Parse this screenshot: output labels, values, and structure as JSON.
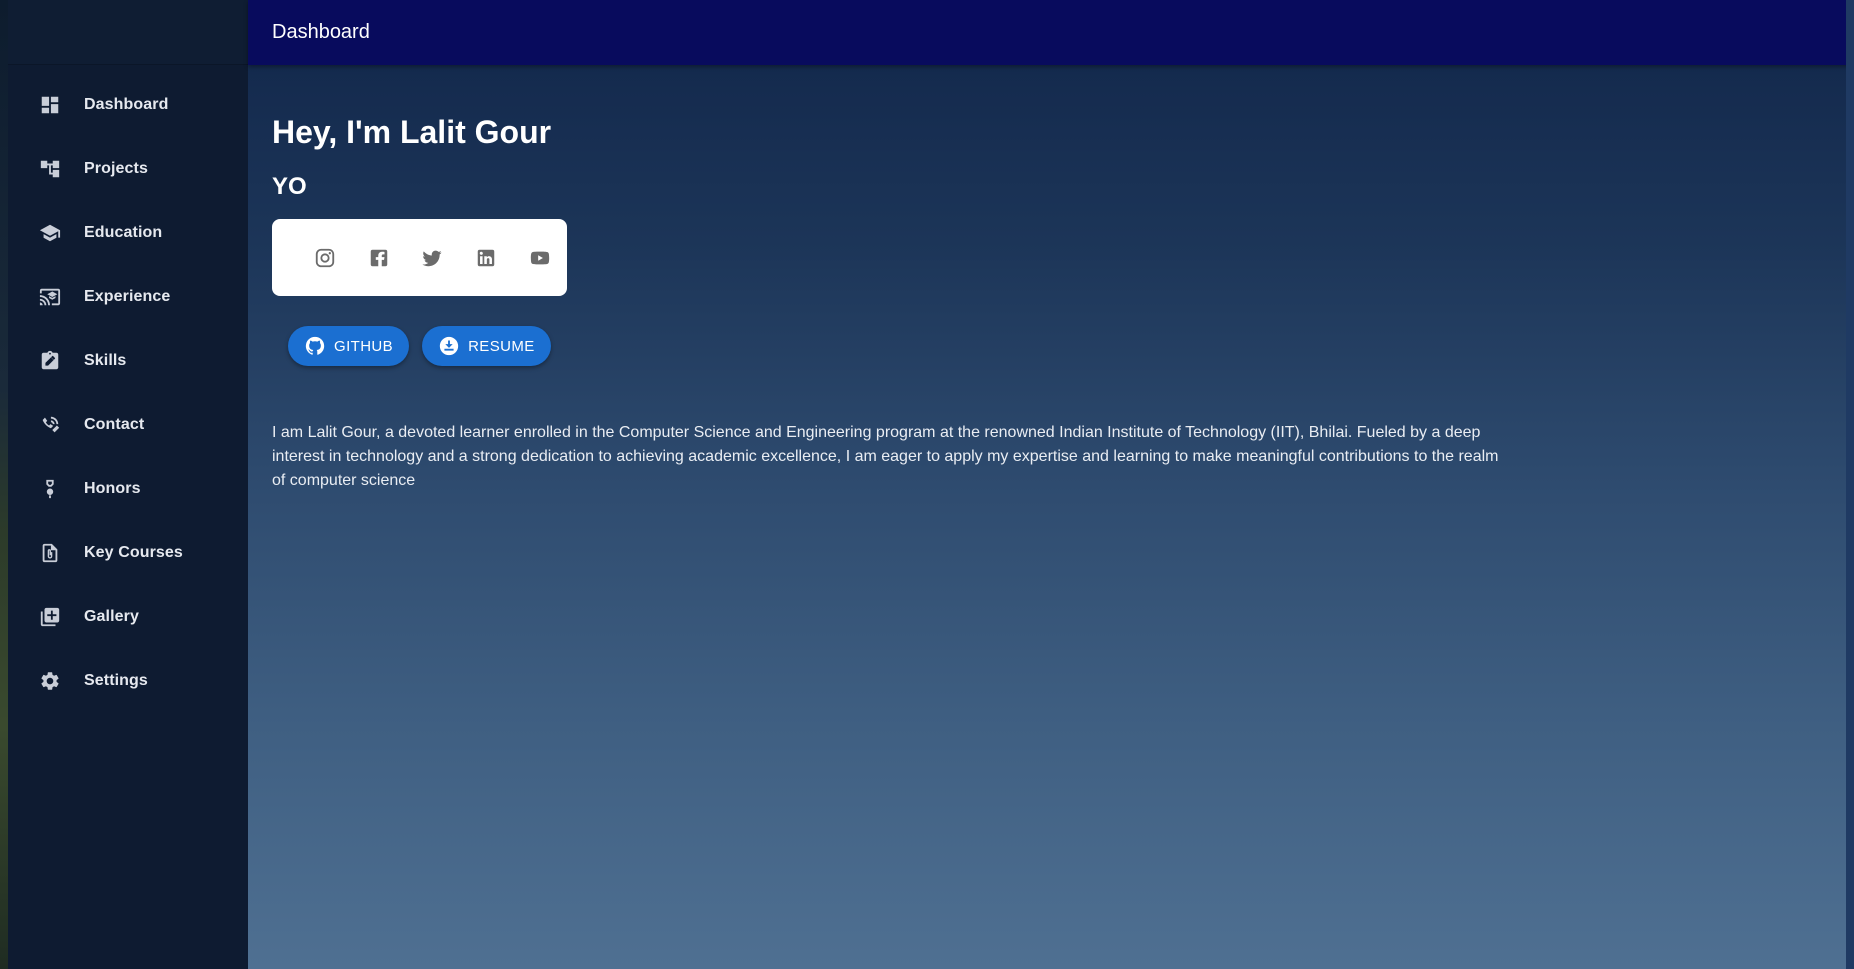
{
  "appbar": {
    "title": "Dashboard"
  },
  "sidebar": {
    "items": [
      {
        "label": "Dashboard",
        "icon": "dashboard-icon"
      },
      {
        "label": "Projects",
        "icon": "projects-icon"
      },
      {
        "label": "Education",
        "icon": "school-icon"
      },
      {
        "label": "Experience",
        "icon": "cast-for-education-icon"
      },
      {
        "label": "Skills",
        "icon": "assignment-icon"
      },
      {
        "label": "Contact",
        "icon": "contact-icon"
      },
      {
        "label": "Honors",
        "icon": "award-icon"
      },
      {
        "label": "Key Courses",
        "icon": "course-file-icon"
      },
      {
        "label": "Gallery",
        "icon": "library-add-icon"
      },
      {
        "label": "Settings",
        "icon": "gear-icon"
      }
    ]
  },
  "hero": {
    "title": "Hey, I'm Lalit Gour",
    "subtitle": "YO"
  },
  "social": [
    "instagram-icon",
    "facebook-icon",
    "twitter-icon",
    "linkedin-icon",
    "youtube-icon"
  ],
  "actions": {
    "github_label": "GITHUB",
    "resume_label": "RESUME"
  },
  "bio": "I am Lalit Gour, a devoted learner enrolled in the Computer Science and Engineering program at the renowned Indian Institute of Technology (IIT), Bhilai. Fueled by a deep interest in technology and a strong dedication to achieving academic excellence, I am eager to apply my expertise and learning to make meaningful contributions to the realm of computer science",
  "colors": {
    "appbar": "#080b5d",
    "sidebar": "#0e1b31",
    "accent": "#1b6fd1"
  }
}
